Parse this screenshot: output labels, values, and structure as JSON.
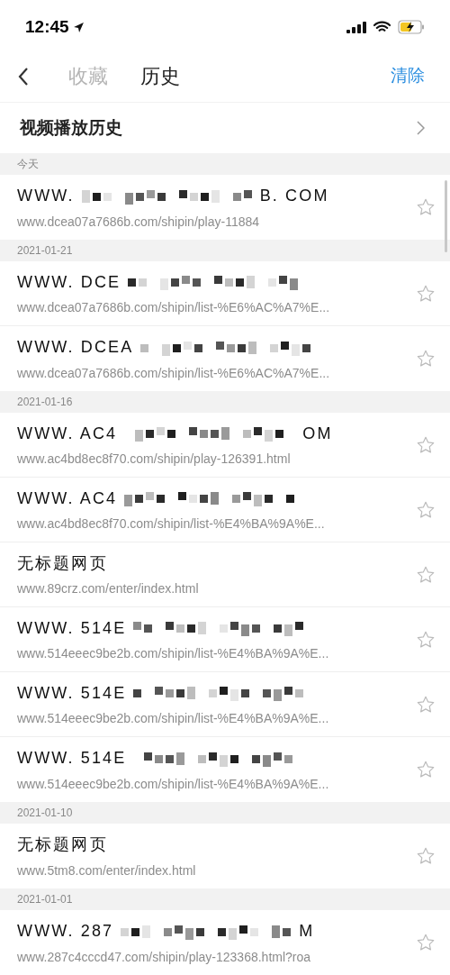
{
  "status_bar": {
    "time": "12:45"
  },
  "nav": {
    "tabs": [
      {
        "label": "收藏",
        "selected": false
      },
      {
        "label": "历史",
        "selected": true
      }
    ],
    "action": "清除"
  },
  "section_link": {
    "label": "视频播放历史"
  },
  "groups": [
    {
      "date": "今天",
      "items": [
        {
          "title_start": "WWW.",
          "title_end": "B. COM",
          "redacted": true,
          "url": "www.dcea07a7686b.com/shipin/play-11884",
          "favorited": false
        }
      ]
    },
    {
      "date": "2021-01-21",
      "items": [
        {
          "title_start": "WWW. DCE",
          "redacted": true,
          "url": "www.dcea07a7686b.com/shipin/list-%E6%AC%A7%E...",
          "favorited": false
        },
        {
          "title_start": "WWW. DCEA",
          "redacted": true,
          "url": "www.dcea07a7686b.com/shipin/list-%E6%AC%A7%E...",
          "favorited": false
        }
      ]
    },
    {
      "date": "2021-01-16",
      "items": [
        {
          "title_start": "WWW. AC4",
          "title_end": "OM",
          "redacted": true,
          "url": "www.ac4bd8ec8f70.com/shipin/play-126391.html",
          "favorited": false
        },
        {
          "title_start": "WWW. AC4",
          "redacted": true,
          "url": "www.ac4bd8ec8f70.com/shipin/list-%E4%BA%9A%E...",
          "favorited": false
        },
        {
          "title_start": "无标题网页",
          "redacted": false,
          "url": "www.89crz.com/enter/index.html",
          "favorited": false
        },
        {
          "title_start": "WWW. 514E",
          "redacted": true,
          "url": "www.514eeec9be2b.com/shipin/list-%E4%BA%9A%E...",
          "favorited": false
        },
        {
          "title_start": "WWW. 514E",
          "redacted": true,
          "url": "www.514eeec9be2b.com/shipin/list-%E4%BA%9A%E...",
          "favorited": false
        },
        {
          "title_start": "WWW. 514E",
          "redacted": true,
          "url": "www.514eeec9be2b.com/shipin/list-%E4%BA%9A%E...",
          "favorited": false
        }
      ]
    },
    {
      "date": "2021-01-10",
      "items": [
        {
          "title_start": "无标题网页",
          "redacted": false,
          "url": "www.5tm8.com/enter/index.html",
          "favorited": false
        }
      ]
    },
    {
      "date": "2021-01-01",
      "items": [
        {
          "title_start": "WWW. 287",
          "title_end": "M",
          "redacted": true,
          "url": "www.287c4cccd47.com/shipin/play-123368.html?roa",
          "favorited": false
        }
      ]
    }
  ]
}
